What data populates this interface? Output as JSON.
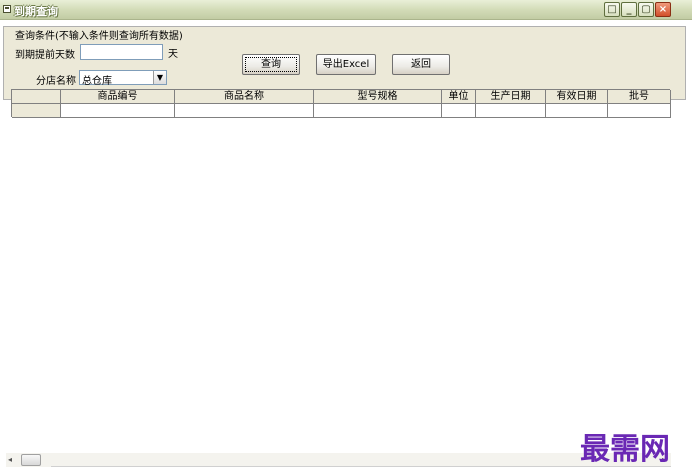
{
  "window": {
    "title": "到期查询",
    "minimize_glyph": "_",
    "restore_glyph": "□",
    "close_glyph": "×"
  },
  "query": {
    "group_title": "查询条件(不输入条件则查询所有数据)",
    "days_label": "到期提前天数",
    "days_value": "",
    "days_unit": "天",
    "store_label": "分店名称",
    "store_value": "总仓库",
    "dropdown_icon": "chevron-down-icon"
  },
  "buttons": {
    "query": "查询",
    "export": "导出Excel",
    "back": "返回"
  },
  "grid": {
    "columns": [
      "商品编号",
      "商品名称",
      "型号规格",
      "单位",
      "生产日期",
      "有效日期",
      "批号"
    ],
    "rows": [
      [
        "",
        "",
        "",
        "",
        "",
        "",
        ""
      ]
    ]
  },
  "scrollbar": {
    "left_arrow": "◂",
    "right_arrow": "▸"
  },
  "watermark": "最需网"
}
